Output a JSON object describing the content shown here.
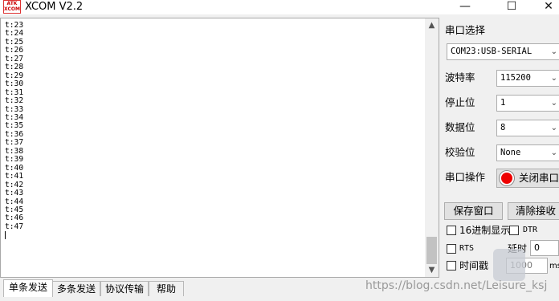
{
  "window": {
    "app_icon_text": "ATK XCOM",
    "title": "XCOM V2.2",
    "minimize_glyph": "—",
    "maximize_glyph": "☐",
    "close_glyph": "✕"
  },
  "receive": {
    "lines": [
      "t:23",
      "t:24",
      "t:25",
      "t:26",
      "t:27",
      "t:28",
      "t:29",
      "t:30",
      "t:31",
      "t:32",
      "t:33",
      "t:34",
      "t:35",
      "t:36",
      "t:37",
      "t:38",
      "t:39",
      "t:40",
      "t:41",
      "t:42",
      "t:43",
      "t:44",
      "t:45",
      "t:46",
      "t:47"
    ],
    "scroll_up_icon": "▲",
    "scroll_down_icon": "▼"
  },
  "tabs": [
    {
      "label": "单条发送"
    },
    {
      "label": "多条发送"
    },
    {
      "label": "协议传输"
    },
    {
      "label": "帮助"
    }
  ],
  "side": {
    "port_select_label": "串口选择",
    "port_value": "COM23:USB-SERIAL",
    "baud_label": "波特率",
    "baud_value": "115200",
    "stop_label": "停止位",
    "stop_value": "1",
    "data_label": "数据位",
    "data_value": "8",
    "parity_label": "校验位",
    "parity_value": "None",
    "port_op_label": "串口操作",
    "port_op_button": "关闭串口",
    "save_button": "保存窗口",
    "clear_button": "清除接收",
    "hex_display_label": "16进制显示",
    "dtr_label": "DTR",
    "rts_label": "RTS",
    "delay_label": "延时",
    "delay_value": "0",
    "timestamp_label": "时间戳",
    "timestamp_value": "1000",
    "ms_label": "ms"
  },
  "watermark": {
    "text": "https://blog.csdn.net/Leisure_ksj"
  },
  "colors": {
    "led_red": "#e00000",
    "title_bar": "#ffffff",
    "panel": "#f0f0f0"
  }
}
